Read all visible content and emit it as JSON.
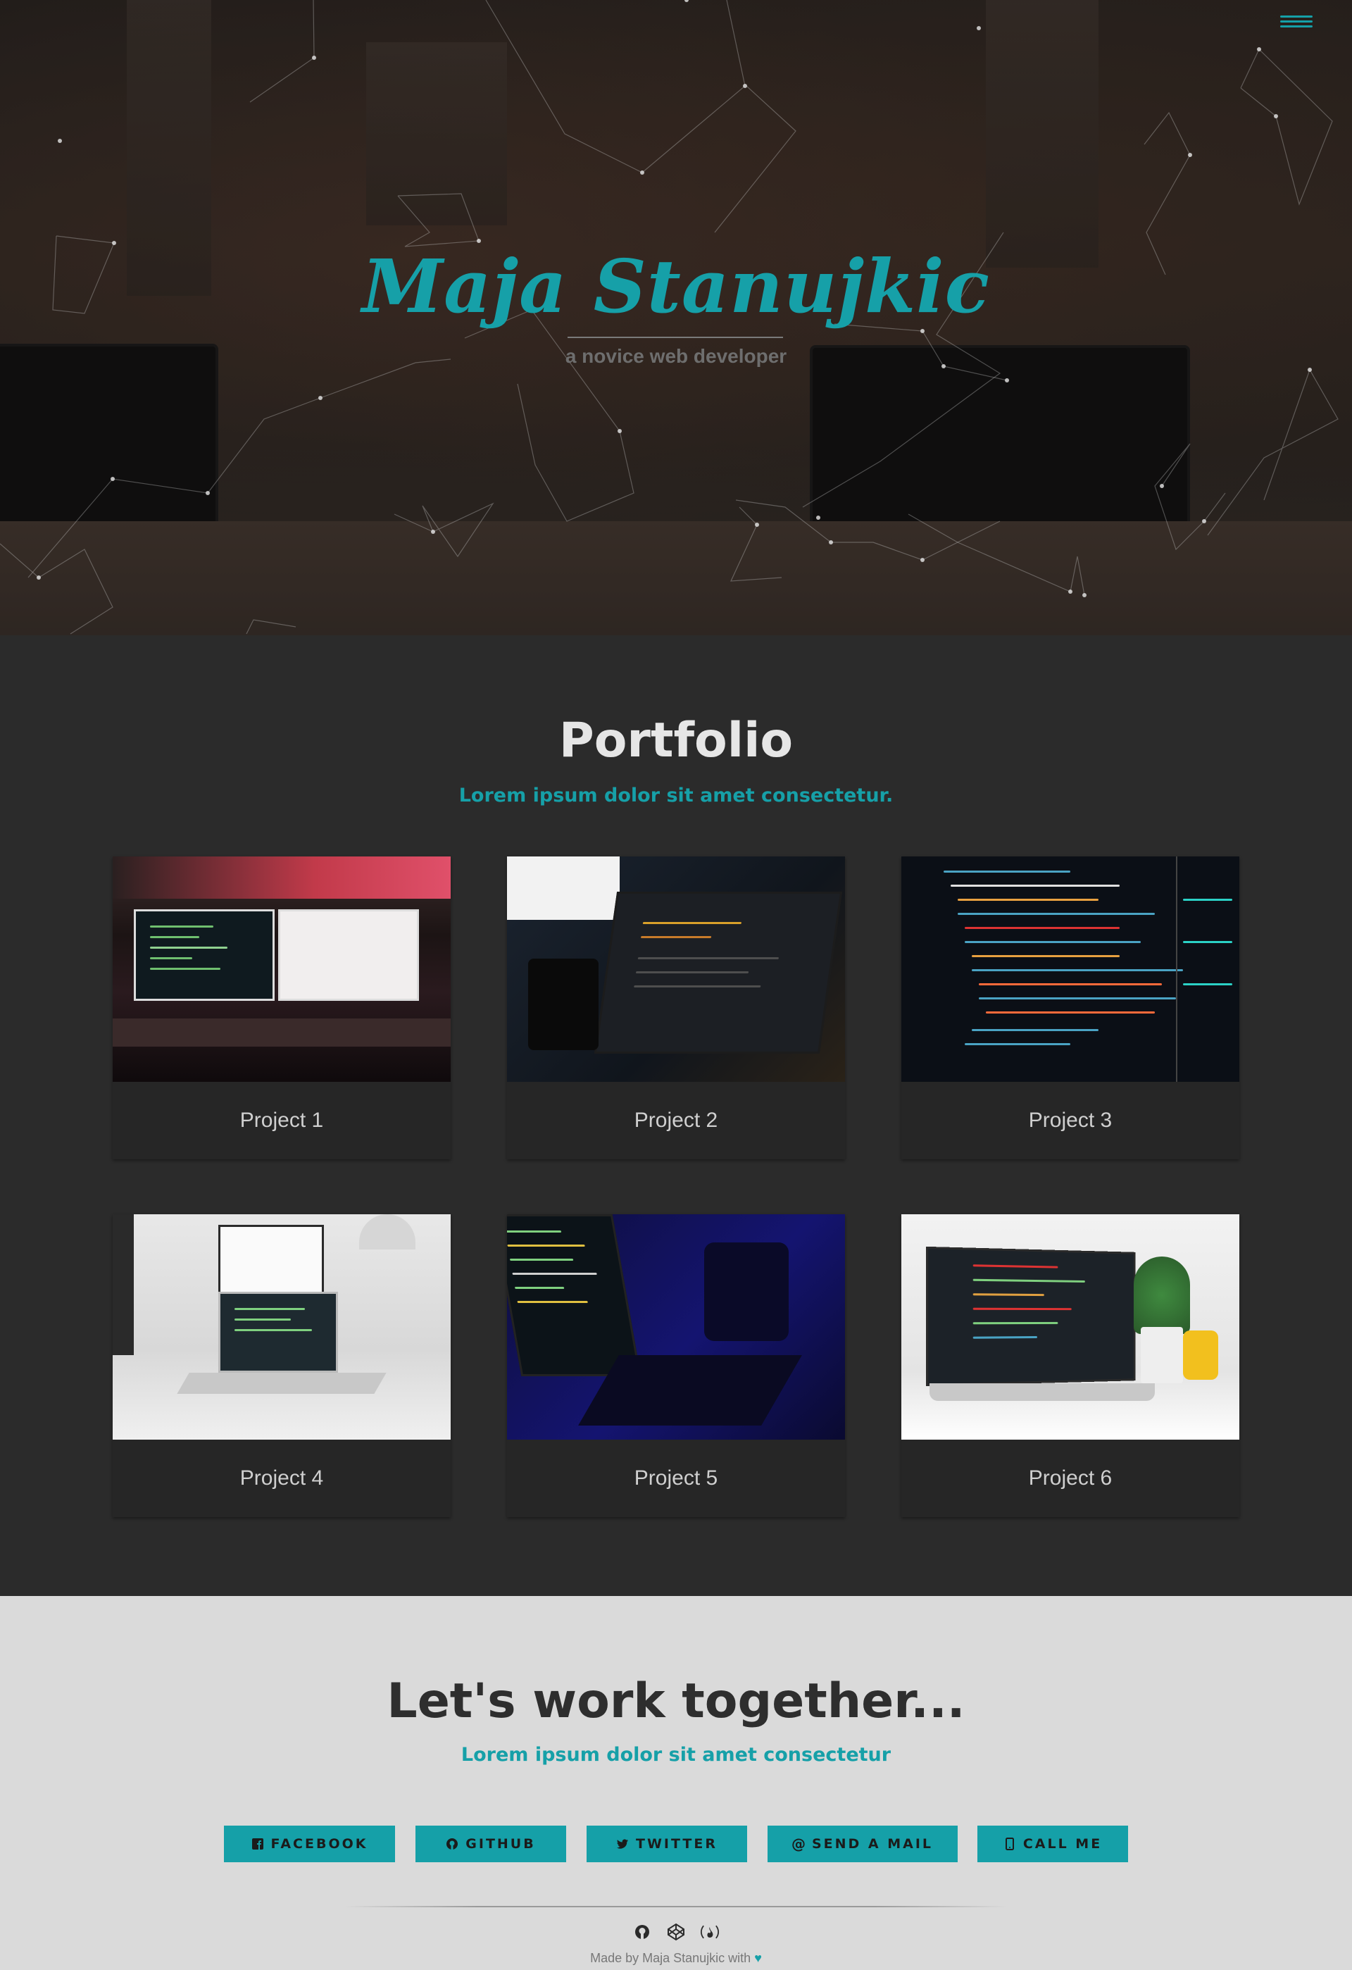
{
  "hero": {
    "name": "Maja Stanujkic",
    "tagline": "a novice web developer",
    "menu_icon": "hamburger-icon"
  },
  "portfolio": {
    "title": "Portfolio",
    "subtitle": "Lorem ipsum dolor sit amet consectetur.",
    "projects": [
      {
        "label": "Project 1"
      },
      {
        "label": "Project 2"
      },
      {
        "label": "Project 3"
      },
      {
        "label": "Project 4"
      },
      {
        "label": "Project 5"
      },
      {
        "label": "Project 6"
      }
    ]
  },
  "contact": {
    "title": "Let's work together...",
    "subtitle": "Lorem ipsum dolor sit amet consectetur",
    "buttons": [
      {
        "label": "FACEBOOK",
        "icon": "facebook-icon"
      },
      {
        "label": "GITHUB",
        "icon": "github-icon"
      },
      {
        "label": "TWITTER",
        "icon": "twitter-icon"
      },
      {
        "label": "SEND A MAIL",
        "icon": "at-icon"
      },
      {
        "label": "CALL ME",
        "icon": "phone-icon"
      }
    ]
  },
  "footer": {
    "icons": [
      "github-icon",
      "codepen-icon",
      "freecodecamp-icon"
    ],
    "credit": "Made by Maja Stanujkic with"
  },
  "colors": {
    "accent": "#16a0a8",
    "dark_bg": "#2b2b2b",
    "light_bg": "#dadada"
  }
}
